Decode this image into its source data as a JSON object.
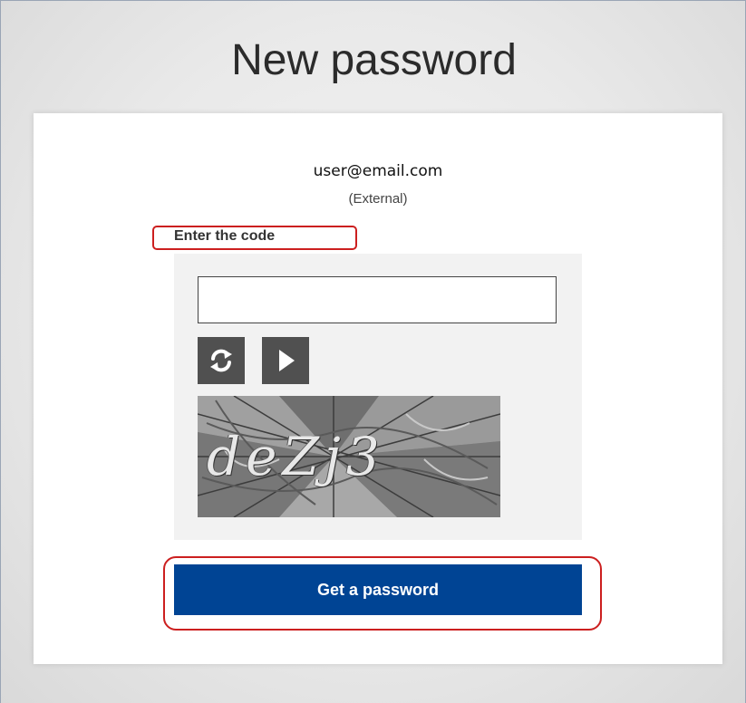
{
  "page": {
    "title": "New password"
  },
  "user": {
    "email": "user@email.com",
    "type": "(External)"
  },
  "captcha": {
    "label": "Enter the code",
    "input_value": "",
    "input_placeholder": "",
    "refresh_icon": "refresh-icon",
    "play_icon": "play-icon",
    "image_text": "deZj3"
  },
  "actions": {
    "submit_label": "Get a password"
  },
  "colors": {
    "primary_button": "#004494",
    "highlight": "#cc1f1f",
    "icon_button": "#505050"
  }
}
